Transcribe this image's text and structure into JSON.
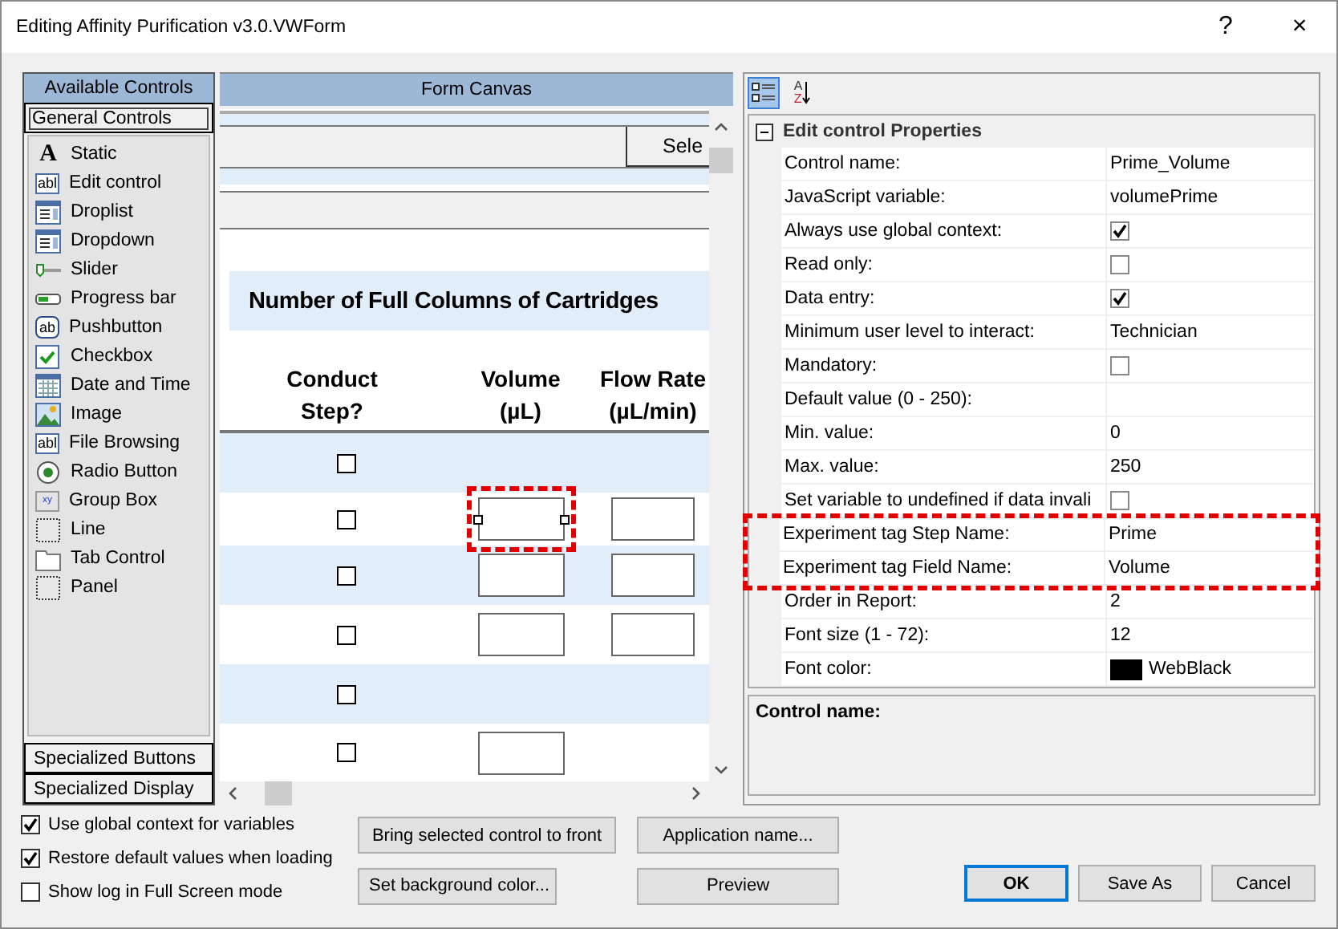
{
  "window": {
    "title": "Editing Affinity Purification v3.0.VWForm",
    "help": "?",
    "close": "×"
  },
  "controls_panel": {
    "title": "Available Controls",
    "tabs": [
      {
        "label": "General Controls",
        "selected": true
      },
      {
        "label": "Specialized Buttons",
        "selected": false
      },
      {
        "label": "Specialized Display",
        "selected": false
      }
    ],
    "items": [
      {
        "label": "Static",
        "kind": "static",
        "icon_text": "A"
      },
      {
        "label": "Edit control",
        "kind": "edit",
        "icon_text": "abl"
      },
      {
        "label": "Droplist",
        "kind": "list"
      },
      {
        "label": "Dropdown",
        "kind": "list"
      },
      {
        "label": "Slider",
        "kind": "slider"
      },
      {
        "label": "Progress bar",
        "kind": "progress"
      },
      {
        "label": "Pushbutton",
        "kind": "push",
        "icon_text": "ab"
      },
      {
        "label": "Checkbox",
        "kind": "checkbox"
      },
      {
        "label": "Date and Time",
        "kind": "calendar"
      },
      {
        "label": "Image",
        "kind": "image"
      },
      {
        "label": "File Browsing",
        "kind": "edit",
        "icon_text": "abl"
      },
      {
        "label": "Radio Button",
        "kind": "radio"
      },
      {
        "label": "Group Box",
        "kind": "group",
        "icon_text": "xy"
      },
      {
        "label": "Line",
        "kind": "dotted"
      },
      {
        "label": "Tab Control",
        "kind": "folder"
      },
      {
        "label": "Panel",
        "kind": "dotted"
      }
    ]
  },
  "canvas": {
    "title": "Form Canvas",
    "cut_button": "Sele",
    "heading": "Number of Full Columns of Cartridges",
    "columns": [
      "Conduct\nStep?",
      "Volume\n(µL)",
      "Flow Rate\n(µL/min)"
    ],
    "rows": [
      {
        "checked": false
      },
      {
        "checked": false,
        "volume_field": {
          "selected": true
        },
        "flow_field": {
          "selected": false
        }
      },
      {
        "checked": false,
        "volume_field": {
          "selected": false
        },
        "flow_field": {
          "selected": false
        }
      },
      {
        "checked": false,
        "volume_field": {
          "selected": false
        },
        "flow_field": {
          "selected": false
        }
      },
      {
        "checked": false
      },
      {
        "checked": false,
        "volume_field": {
          "selected": false
        }
      }
    ]
  },
  "properties": {
    "toolbar": [
      {
        "kind": "categorized",
        "selected": true
      },
      {
        "kind": "alphabetical",
        "selected": false,
        "icon_top": "A",
        "icon_bottom": "Z"
      }
    ],
    "category": {
      "title": "Edit control Properties",
      "expanded": true
    },
    "rows": [
      {
        "label": "Control name:",
        "kind": "text",
        "value": "Prime_Volume",
        "highlighted": false
      },
      {
        "label": "JavaScript variable:",
        "kind": "text",
        "value": "volumePrime",
        "highlighted": false
      },
      {
        "label": "Always use global context:",
        "kind": "checkbox",
        "checked": true,
        "highlighted": false
      },
      {
        "label": "Read only:",
        "kind": "checkbox",
        "checked": false,
        "highlighted": false
      },
      {
        "label": "Data entry:",
        "kind": "checkbox",
        "checked": true,
        "highlighted": false
      },
      {
        "label": "Minimum user level to interact:",
        "kind": "text",
        "value": "Technician",
        "highlighted": false
      },
      {
        "label": "Mandatory:",
        "kind": "checkbox",
        "checked": false,
        "highlighted": false
      },
      {
        "label": "Default value (0 - 250):",
        "kind": "text",
        "highlighted": false
      },
      {
        "label": "Min. value:",
        "kind": "text",
        "value": "0",
        "highlighted": false
      },
      {
        "label": "Max. value:",
        "kind": "text",
        "value": "250",
        "highlighted": false
      },
      {
        "label": "Set variable to undefined if data invali",
        "kind": "checkbox",
        "checked": false,
        "highlighted": false
      },
      {
        "label": "Experiment tag Step Name:",
        "kind": "text",
        "value": "Prime",
        "highlighted": true
      },
      {
        "label": "Experiment tag Field Name:",
        "kind": "text",
        "value": "Volume",
        "highlighted": true
      },
      {
        "label": "Order in Report:",
        "kind": "text",
        "value": "2",
        "highlighted": false
      },
      {
        "label": "Font size (1 - 72):",
        "kind": "text",
        "value": "12",
        "highlighted": false
      },
      {
        "label": "Font color:",
        "kind": "color",
        "value": "WebBlack",
        "color": "#000000",
        "highlighted": false
      }
    ],
    "description": "Control name:"
  },
  "options": [
    {
      "label": "Use global context for variables",
      "checked": true
    },
    {
      "label": "Restore default values when loading",
      "checked": true
    },
    {
      "label": "Show log in Full Screen mode",
      "checked": false
    }
  ],
  "tool_buttons": [
    [
      "Bring selected control to front",
      "Application name..."
    ],
    [
      "Set background color...",
      "Preview"
    ]
  ],
  "dialog_buttons": [
    {
      "label": "OK",
      "default": true
    },
    {
      "label": "Save As",
      "default": false
    },
    {
      "label": "Cancel",
      "default": false
    }
  ]
}
